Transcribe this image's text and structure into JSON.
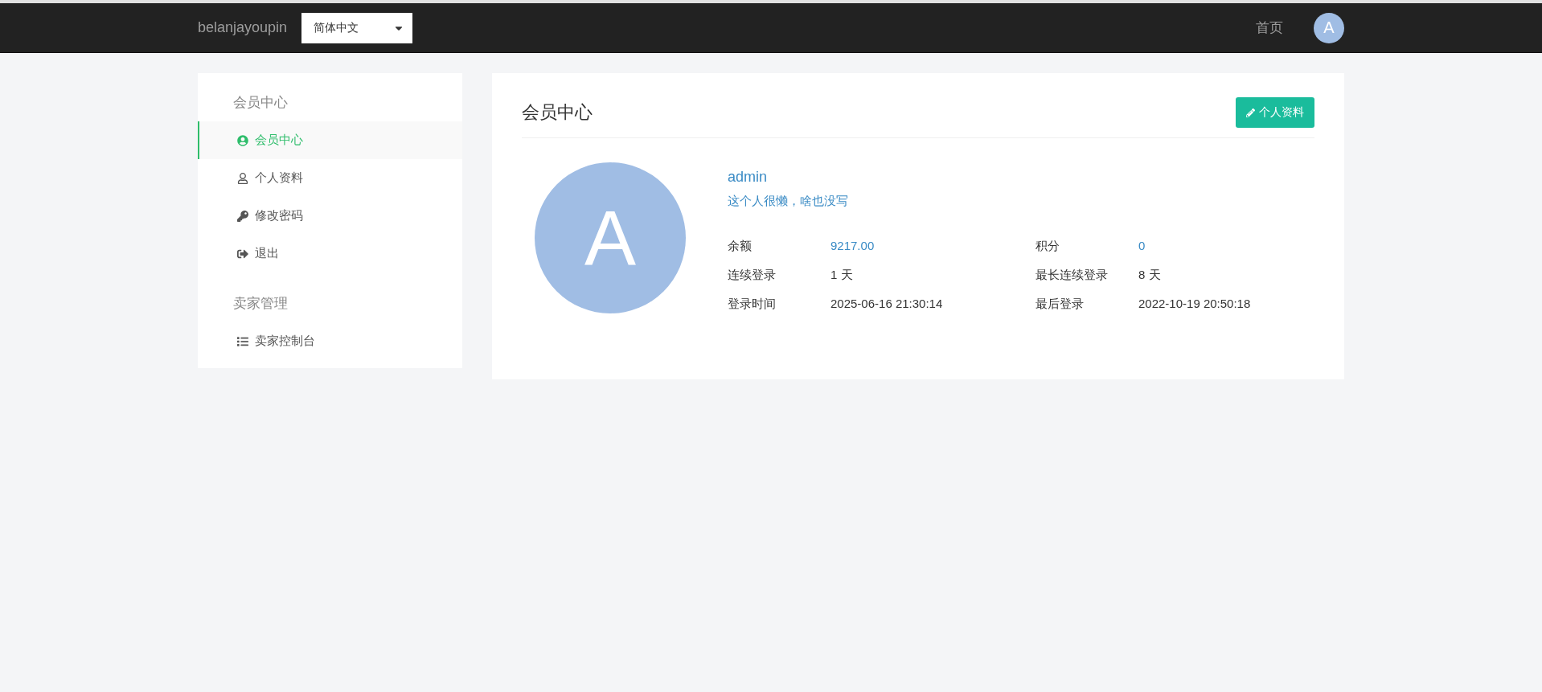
{
  "navbar": {
    "brand": "belanjayoupin",
    "language_select": {
      "value": "简体中文"
    },
    "links": [
      {
        "label": "首页"
      }
    ],
    "avatar": {
      "letter": "A"
    }
  },
  "sidebar": {
    "sections": [
      {
        "title": "会员中心",
        "items": [
          {
            "label": "会员中心",
            "selected": true
          },
          {
            "label": "个人资料",
            "selected": false
          },
          {
            "label": "修改密码",
            "selected": false
          },
          {
            "label": "退出",
            "selected": false
          }
        ]
      },
      {
        "title": "卖家管理",
        "items": [
          {
            "label": "卖家控制台",
            "selected": false
          }
        ]
      }
    ]
  },
  "profile": {
    "title": "会员中心",
    "edit_button": "个人资料",
    "avatar_letter": "A",
    "username": "admin",
    "bio": "这个人很懒，啥也没写",
    "stats": [
      {
        "label": "余额",
        "value": "9217.00",
        "kind": "link"
      },
      {
        "label": "积分",
        "value": "0",
        "kind": "link"
      },
      {
        "label": "连续登录",
        "value": "1 天",
        "kind": "text"
      },
      {
        "label": "最长连续登录",
        "value": "8 天",
        "kind": "text"
      },
      {
        "label": "登录时间",
        "value": "2025-06-16 21:30:14",
        "kind": "text"
      },
      {
        "label": "最后登录",
        "value": "2022-10-19 20:50:18",
        "kind": "text"
      }
    ]
  }
}
